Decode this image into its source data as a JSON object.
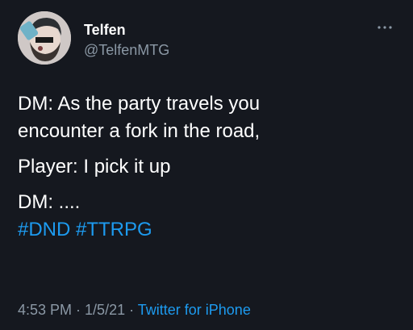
{
  "author": {
    "name": "Telfen",
    "handle": "@TelfenMTG"
  },
  "tweet": {
    "lines": [
      "DM: As the party travels you",
      "encounter a fork in the road,",
      "Player: I pick it up",
      "DM: ...."
    ],
    "hashtags": [
      "#DND",
      "#TTRPG"
    ]
  },
  "meta": {
    "time": "4:53 PM",
    "separator": " · ",
    "date": "1/5/21",
    "source": "Twitter for iPhone"
  },
  "colors": {
    "background": "#15181f",
    "link": "#1d9bf0",
    "secondary_text": "#8b98a5"
  },
  "icons": {
    "more": "more-options-icon"
  }
}
